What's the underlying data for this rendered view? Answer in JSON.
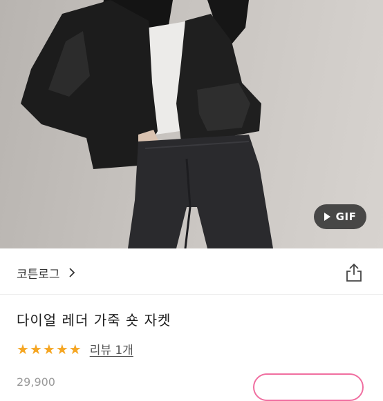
{
  "photo": {
    "gif_badge": "GIF"
  },
  "store": {
    "name": "코튼로그"
  },
  "product": {
    "title": "다이얼 레더 가죽 숏 자켓",
    "rating_stars": 5,
    "review_link": "리뷰 1개",
    "price_partial": "29,900"
  },
  "colors": {
    "star": "#f5a623",
    "accent_pink": "#f06ea0"
  },
  "icons": {
    "store_chevron": "chevron-right-icon",
    "share": "share-icon",
    "gif_play": "play-icon"
  }
}
